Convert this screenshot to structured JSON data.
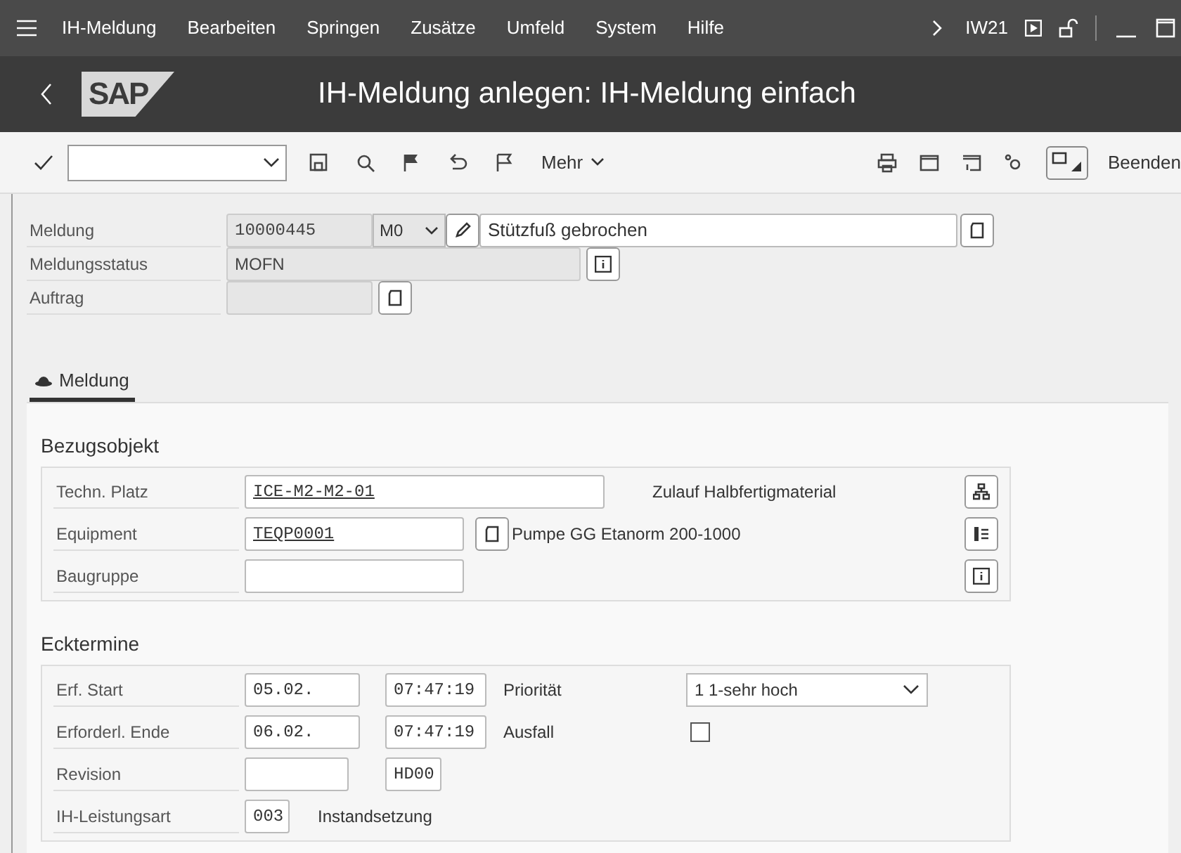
{
  "menu": {
    "items": [
      "IH-Meldung",
      "Bearbeiten",
      "Springen",
      "Zusätze",
      "Umfeld",
      "System",
      "Hilfe"
    ],
    "transaction": "IW21"
  },
  "logo": "SAP",
  "title": "IH-Meldung anlegen: IH-Meldung einfach",
  "toolbar": {
    "more": "Mehr",
    "exit": "Beenden"
  },
  "header": {
    "meldung": {
      "label": "Meldung",
      "number": "10000445",
      "type": "M0",
      "description": "Stützfuß gebrochen"
    },
    "status": {
      "label": "Meldungsstatus",
      "value": "MOFN"
    },
    "auftrag": {
      "label": "Auftrag"
    }
  },
  "tabs": [
    {
      "label": "Meldung",
      "selected": true
    }
  ],
  "bezugsobjekt": {
    "title": "Bezugsobjekt",
    "rows": [
      {
        "label": "Techn. Platz",
        "value": "ICE-M2-M2-01",
        "description": "Zulauf Halbfertigmaterial"
      },
      {
        "label": "Equipment",
        "value": "TEQP0001",
        "description": "Pumpe GG Etanorm 200-1000"
      },
      {
        "label": "Baugruppe"
      }
    ]
  },
  "ecktermine": {
    "title": "Ecktermine",
    "rows": [
      {
        "label": "Erf. Start",
        "date": "05.02.",
        "time": "07:47:19",
        "extra_label": "Priorität",
        "priority": "1 1-sehr hoch"
      },
      {
        "label": "Erforderl. Ende",
        "date": "06.02.",
        "time": "07:47:19",
        "extra_label": "Ausfall",
        "checked": false
      },
      {
        "label": "Revision",
        "code": "HD00"
      },
      {
        "label": "IH-Leistungsart",
        "code": "003",
        "description": "Instandsetzung"
      }
    ]
  }
}
